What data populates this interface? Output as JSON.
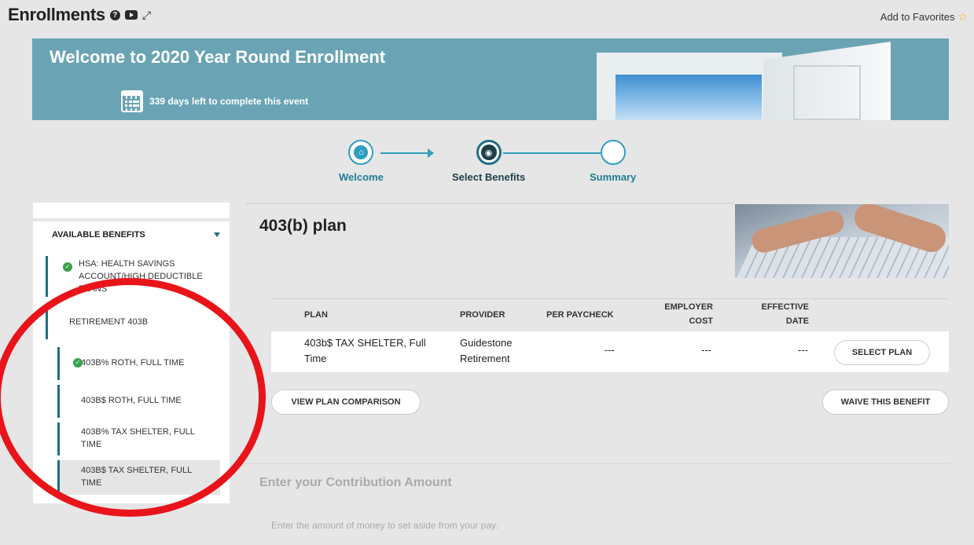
{
  "header": {
    "title": "Enrollments",
    "help_glyph": "?",
    "expand_glyph": "⤢",
    "favorites_label": "Add to Favorites",
    "star_glyph": "☆"
  },
  "banner": {
    "title": "Welcome to 2020 Year Round Enrollment",
    "days_left": "339 days left to complete this event"
  },
  "stepper": {
    "steps": [
      {
        "label": "Welcome",
        "icon": "home-icon",
        "glyph": "⌂"
      },
      {
        "label": "Select Benefits",
        "icon": "eye-icon",
        "glyph": "◉"
      },
      {
        "label": "Summary",
        "icon": "empty-circle-icon"
      }
    ]
  },
  "sidebar": {
    "header": "AVAILABLE BENEFITS",
    "check_glyph": "✓",
    "items": [
      {
        "label": "HSA: HEALTH SAVINGS ACCOUNT/HIGH DEDUCTIBLE PLANS",
        "checked": true
      },
      {
        "label": "RETIREMENT 403B",
        "checked": false
      },
      {
        "label": "403B% ROTH, FULL TIME",
        "checked": true
      },
      {
        "label": "403B$ ROTH, FULL TIME",
        "checked": false
      },
      {
        "label": "403B% TAX SHELTER, FULL TIME",
        "checked": false
      },
      {
        "label": "403B$ TAX SHELTER, FULL TIME",
        "checked": false,
        "selected": true
      }
    ]
  },
  "main": {
    "plan_title": "403(b) plan",
    "table": {
      "headers": {
        "plan": "PLAN",
        "provider": "PROVIDER",
        "per_paycheck": "PER PAYCHECK",
        "employer_cost_1": "EMPLOYER",
        "employer_cost_2": "COST",
        "effective_date_1": "EFFECTIVE",
        "effective_date_2": "DATE"
      },
      "rows": [
        {
          "plan_line1": "403b$ TAX SHELTER, Full",
          "plan_line2": "Time",
          "provider_line1": "Guidestone",
          "provider_line2": "Retirement",
          "per_paycheck": "---",
          "employer_cost": "---",
          "effective_date": "---",
          "action": "SELECT PLAN"
        }
      ]
    },
    "view_comparison": "VIEW PLAN COMPARISON",
    "waive": "WAIVE THIS BENEFIT",
    "contribution_title": "Enter your Contribution Amount",
    "contribution_desc": "Enter the amount of money to set aside from your pay."
  },
  "colors": {
    "banner": "#6aa4b4",
    "accent": "#1f6f80",
    "step_blue": "#2e9fc1",
    "check_green": "#3aa14b",
    "annotation_red": "#e8141a"
  }
}
